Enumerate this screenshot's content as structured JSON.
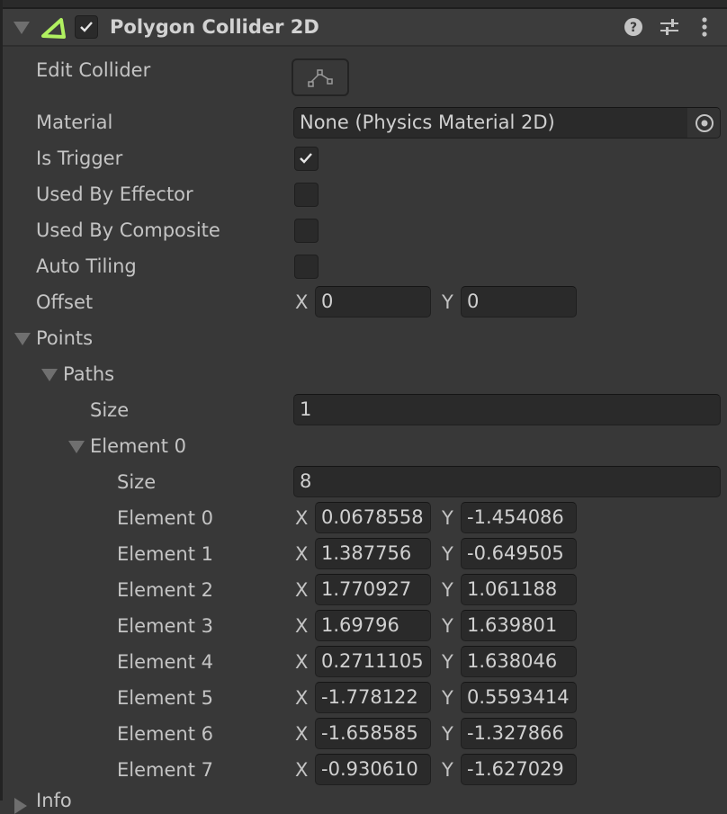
{
  "component": {
    "title": "Polygon Collider 2D",
    "enabled": true,
    "icon": "polygon-collider-icon",
    "accent_color": "#b0f060",
    "header_icons": [
      "help-icon",
      "presets-icon",
      "more-menu-icon"
    ]
  },
  "properties": {
    "edit_collider": {
      "label": "Edit Collider",
      "icon": "edit-collider-icon"
    },
    "material": {
      "label": "Material",
      "value": "None (Physics Material 2D)",
      "icon": "object-picker-icon"
    },
    "is_trigger": {
      "label": "Is Trigger",
      "checked": true
    },
    "used_by_effector": {
      "label": "Used By Effector",
      "checked": false
    },
    "used_by_composite": {
      "label": "Used By Composite",
      "checked": false
    },
    "auto_tiling": {
      "label": "Auto Tiling",
      "checked": false
    },
    "offset": {
      "label": "Offset",
      "x_label": "X",
      "x": "0",
      "y_label": "Y",
      "y": "0"
    }
  },
  "points": {
    "label": "Points",
    "paths": {
      "label": "Paths",
      "size_label": "Size",
      "size": "1",
      "element": {
        "label": "Element 0",
        "size_label": "Size",
        "size": "8",
        "items": [
          {
            "label": "Element 0",
            "x": "0.0678558",
            "y": "-1.454086"
          },
          {
            "label": "Element 1",
            "x": "1.387756",
            "y": "-0.649505"
          },
          {
            "label": "Element 2",
            "x": "1.770927",
            "y": "1.061188"
          },
          {
            "label": "Element 3",
            "x": "1.69796",
            "y": "1.639801"
          },
          {
            "label": "Element 4",
            "x": "0.2711105",
            "y": "1.638046"
          },
          {
            "label": "Element 5",
            "x": "-1.778122",
            "y": "0.5593414"
          },
          {
            "label": "Element 6",
            "x": "-1.658585",
            "y": "-1.327866"
          },
          {
            "label": "Element 7",
            "x": "-0.930610",
            "y": "-1.627029"
          }
        ]
      }
    }
  },
  "info": {
    "label": "Info"
  },
  "axis": {
    "x": "X",
    "y": "Y"
  }
}
